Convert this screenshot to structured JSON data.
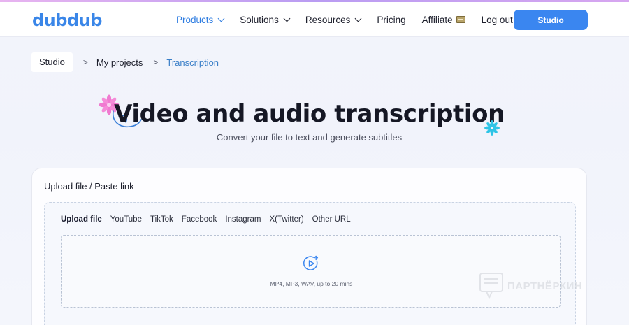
{
  "header": {
    "logo_text": "dubdub",
    "nav": {
      "products": "Products",
      "solutions": "Solutions",
      "resources": "Resources",
      "pricing": "Pricing",
      "affiliate": "Affiliate",
      "logout": "Log out"
    },
    "studio_button": "Studio"
  },
  "breadcrumb": {
    "home": "Studio",
    "sep": ">",
    "projects": "My projects",
    "current": "Transcription"
  },
  "hero": {
    "title": "Video and audio transcription",
    "subtitle": "Convert your file to text and generate subtitles"
  },
  "card": {
    "title": "Upload file / Paste link",
    "tabs": [
      "Upload file",
      "YouTube",
      "TikTok",
      "Facebook",
      "Instagram",
      "X(Twitter)",
      "Other URL"
    ],
    "active_tab": "Upload file",
    "dropzone_hint": "MP4, MP3, WAV, up to 20 mins"
  },
  "watermark": "ПАРТНЁРКИН",
  "colors": {
    "accent": "#3a86f0",
    "active_nav": "#2f7de1",
    "breadcrumb_current": "#3a7fc8",
    "flower_pink": "#f07ad0",
    "flower_cyan": "#2ec4e6"
  },
  "icons": {
    "upload": "play-circle-upload-icon",
    "nav_dropdown": "chevron-down-icon",
    "affiliate": "affiliate-badge-icon",
    "decor_left": "flower-icon",
    "decor_right": "flower-icon"
  }
}
